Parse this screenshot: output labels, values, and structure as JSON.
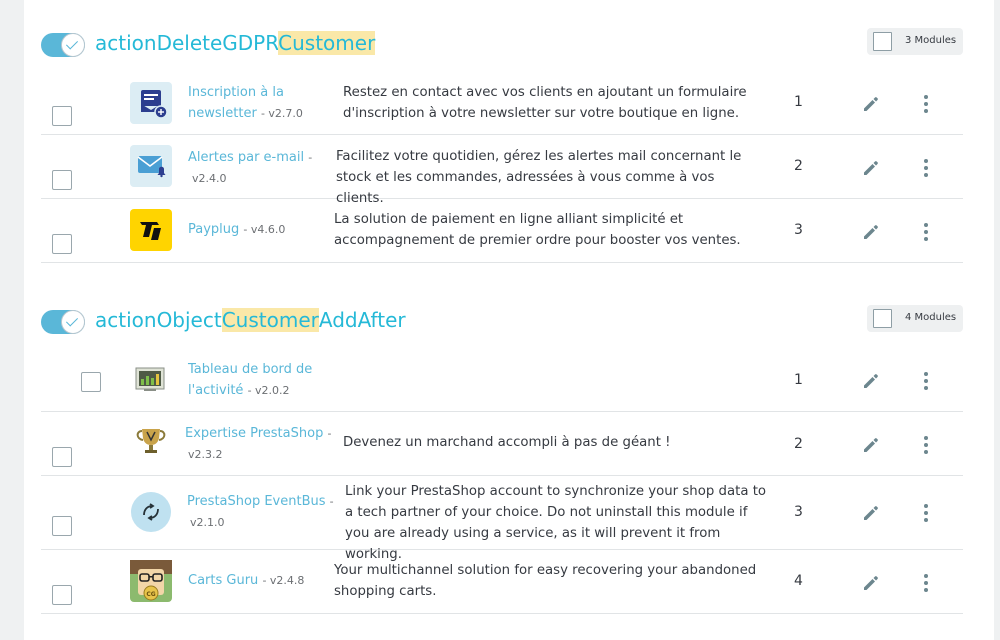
{
  "hooks": [
    {
      "title_before": "actionDeleteGDPR",
      "title_highlight": "Customer",
      "title_after": "",
      "modules_count_label": "3 Modules",
      "modules": [
        {
          "name": "Inscription à la newsletter",
          "version": "- v2.7.0",
          "description": "Restez en contact avec vos clients en ajoutant un formulaire d'inscription à votre newsletter sur votre boutique en ligne.",
          "position": "1",
          "icon": "newsletter-icon"
        },
        {
          "name": "Alertes par e-mail",
          "name_suffix": "-",
          "version": "v2.4.0",
          "description": "Facilitez votre quotidien, gérez les alertes mail concernant le stock et les commandes, adressées à vous comme à vos clients.",
          "position": "2",
          "icon": "mail-alert-icon"
        },
        {
          "name": "Payplug",
          "version": "- v4.6.0",
          "description": "La solution de paiement en ligne alliant simplicité et accompagnement de premier ordre pour booster vos ventes.",
          "position": "3",
          "icon": "payplug-logo"
        }
      ]
    },
    {
      "title_before": "actionObject",
      "title_highlight": "Customer",
      "title_after": "AddAfter",
      "modules_count_label": "4 Modules",
      "modules": [
        {
          "name": "Tableau de bord de l'activité",
          "version": "- v2.0.2",
          "description": "",
          "position": "1",
          "icon": "dashboard-activity-icon"
        },
        {
          "name": "Expertise PrestaShop",
          "name_suffix": "-",
          "version": "v2.3.2",
          "description": "Devenez un marchand accompli à pas de géant !",
          "position": "2",
          "icon": "trophy-icon"
        },
        {
          "name": "PrestaShop EventBus",
          "name_suffix": "-",
          "version": "v2.1.0",
          "description": "Link your PrestaShop account to synchronize your shop data to a tech partner of your choice. Do not uninstall this module if you are already using a service, as it will prevent it from working.",
          "position": "3",
          "icon": "eventbus-icon"
        },
        {
          "name": "Carts Guru",
          "version": "- v2.4.8",
          "description": "Your multichannel solution for easy recovering your abandoned shopping carts.",
          "position": "4",
          "icon": "cartsguru-logo"
        }
      ]
    }
  ],
  "colors": {
    "accent": "#25b9d7",
    "link": "#5ab7d8",
    "highlight": "#fae8a8",
    "toggle_on": "#5ab7d8",
    "payplug_yellow": "#ffd400"
  }
}
